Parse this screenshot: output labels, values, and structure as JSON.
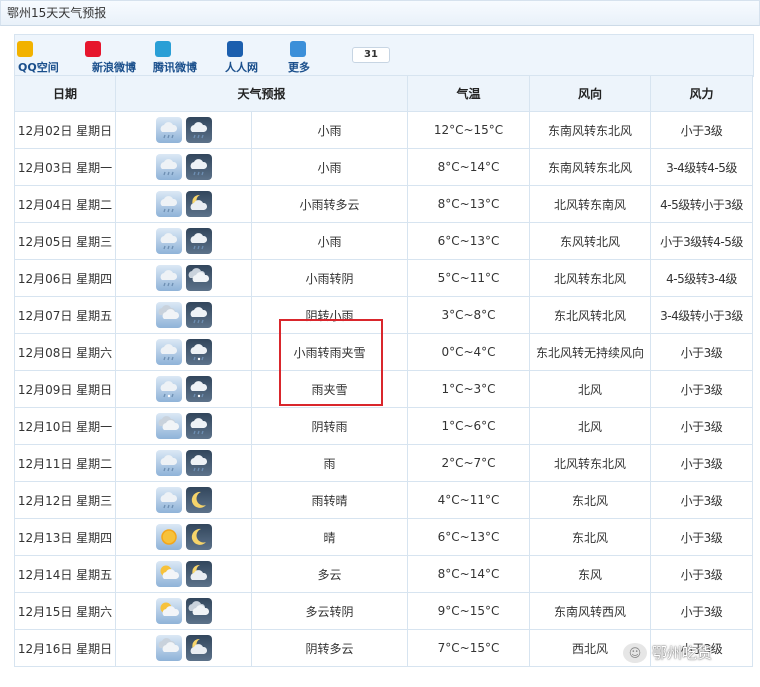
{
  "header": {
    "title": "鄂州15天天气预报"
  },
  "share": {
    "items": [
      {
        "label": "QQ空间",
        "icon": "qzone-icon",
        "color": "#f2b200"
      },
      {
        "label": "新浪微博",
        "icon": "weibo-icon",
        "color": "#e6162d"
      },
      {
        "label": "腾讯微博",
        "icon": "tencent-weibo-icon",
        "color": "#2a9fd6"
      },
      {
        "label": "人人网",
        "icon": "renren-icon",
        "color": "#1c5fae"
      },
      {
        "label": "更多",
        "icon": "plus-icon",
        "color": "#3b8fd9"
      }
    ],
    "count": "31"
  },
  "table": {
    "headers": [
      "日期",
      "天气预报",
      "气温",
      "风向",
      "风力"
    ],
    "rows": [
      {
        "date": "12月02日 星期日",
        "day_icon": "rain",
        "night_icon": "rain",
        "weather": "小雨",
        "temp": "12°C~15°C",
        "wind_dir": "东南风转东北风",
        "wind_force": "小于3级"
      },
      {
        "date": "12月03日 星期一",
        "day_icon": "rain",
        "night_icon": "rain",
        "weather": "小雨",
        "temp": "8°C~14°C",
        "wind_dir": "东南风转东北风",
        "wind_force": "3-4级转4-5级"
      },
      {
        "date": "12月04日 星期二",
        "day_icon": "rain",
        "night_icon": "cloudy-night",
        "weather": "小雨转多云",
        "temp": "8°C~13°C",
        "wind_dir": "北风转东南风",
        "wind_force": "4-5级转小于3级"
      },
      {
        "date": "12月05日 星期三",
        "day_icon": "rain",
        "night_icon": "rain",
        "weather": "小雨",
        "temp": "6°C~13°C",
        "wind_dir": "东风转北风",
        "wind_force": "小于3级转4-5级"
      },
      {
        "date": "12月06日 星期四",
        "day_icon": "rain",
        "night_icon": "overcast",
        "weather": "小雨转阴",
        "temp": "5°C~11°C",
        "wind_dir": "北风转东北风",
        "wind_force": "4-5级转3-4级"
      },
      {
        "date": "12月07日 星期五",
        "day_icon": "overcast",
        "night_icon": "rain",
        "weather": "阴转小雨",
        "temp": "3°C~8°C",
        "wind_dir": "东北风转北风",
        "wind_force": "3-4级转小于3级"
      },
      {
        "date": "12月08日 星期六",
        "day_icon": "rain",
        "night_icon": "sleet",
        "weather": "小雨转雨夹雪",
        "temp": "0°C~4°C",
        "wind_dir": "东北风转无持续风向",
        "wind_force": "小于3级"
      },
      {
        "date": "12月09日 星期日",
        "day_icon": "sleet",
        "night_icon": "sleet",
        "weather": "雨夹雪",
        "temp": "1°C~3°C",
        "wind_dir": "北风",
        "wind_force": "小于3级"
      },
      {
        "date": "12月10日 星期一",
        "day_icon": "overcast",
        "night_icon": "rain",
        "weather": "阴转雨",
        "temp": "1°C~6°C",
        "wind_dir": "北风",
        "wind_force": "小于3级"
      },
      {
        "date": "12月11日 星期二",
        "day_icon": "rain",
        "night_icon": "rain",
        "weather": "雨",
        "temp": "2°C~7°C",
        "wind_dir": "北风转东北风",
        "wind_force": "小于3级"
      },
      {
        "date": "12月12日 星期三",
        "day_icon": "rain",
        "night_icon": "moon",
        "weather": "雨转晴",
        "temp": "4°C~11°C",
        "wind_dir": "东北风",
        "wind_force": "小于3级"
      },
      {
        "date": "12月13日 星期四",
        "day_icon": "sun",
        "night_icon": "moon",
        "weather": "晴",
        "temp": "6°C~13°C",
        "wind_dir": "东北风",
        "wind_force": "小于3级"
      },
      {
        "date": "12月14日 星期五",
        "day_icon": "partly-cloudy",
        "night_icon": "cloudy-night",
        "weather": "多云",
        "temp": "8°C~14°C",
        "wind_dir": "东风",
        "wind_force": "小于3级"
      },
      {
        "date": "12月15日 星期六",
        "day_icon": "partly-cloudy",
        "night_icon": "overcast",
        "weather": "多云转阴",
        "temp": "9°C~15°C",
        "wind_dir": "东南风转西风",
        "wind_force": "小于3级"
      },
      {
        "date": "12月16日 星期日",
        "day_icon": "overcast",
        "night_icon": "cloudy-night",
        "weather": "阴转多云",
        "temp": "7°C~15°C",
        "wind_dir": "西北风",
        "wind_force": "小于3级"
      }
    ]
  },
  "watermark": {
    "text": "鄂州吃货"
  }
}
